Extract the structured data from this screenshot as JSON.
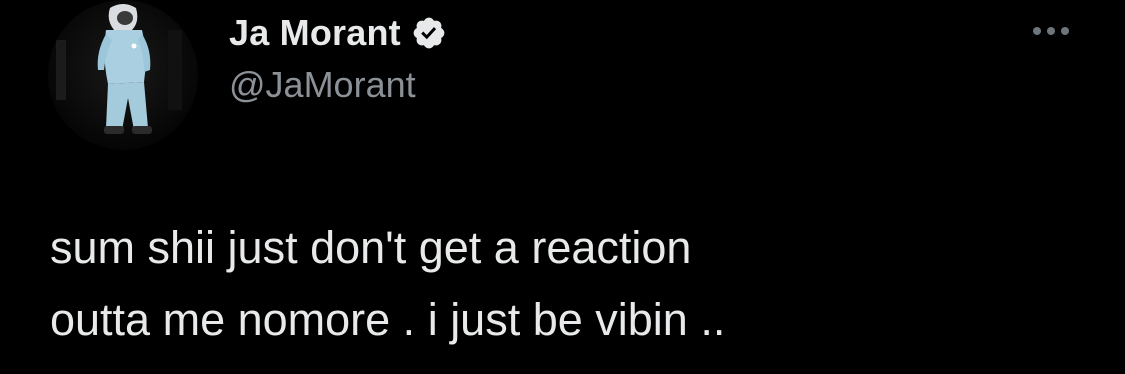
{
  "tweet": {
    "author": {
      "display_name": "Ja Morant",
      "handle": "@JaMorant",
      "verified": true,
      "avatar_icon": "profile-photo"
    },
    "more_icon": "more-options-icon",
    "text": "sum shii just don't get a reaction\noutta me nomore . i just be vibin .."
  },
  "colors": {
    "background": "#000000",
    "primary_text": "#e7e9ea",
    "secondary_text": "#8b9196",
    "verified_badge": "#e7e9ea"
  }
}
